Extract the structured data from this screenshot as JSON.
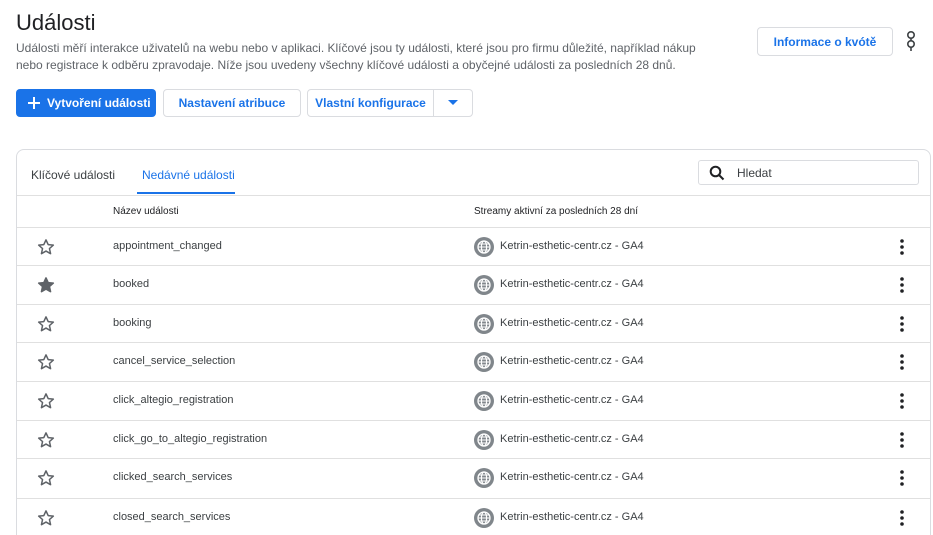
{
  "header": {
    "title": "Události",
    "description": "Události měří interakce uživatelů na webu nebo v aplikaci. Klíčové jsou ty události, které jsou pro firmu důležité, například nákup nebo registrace k odběru zpravodaje. Níže jsou uvedeny všechny klíčové události a obyčejné události za posledních 28 dnů.",
    "quota_label": "Informace o kvótě"
  },
  "toolbar": {
    "create_label": "Vytvoření události",
    "attribution_label": "Nastavení atribuce",
    "custom_config_label": "Vlastní konfigurace"
  },
  "tabs": [
    {
      "label": "Klíčové události",
      "active": false
    },
    {
      "label": "Nedávné události",
      "active": true
    }
  ],
  "search": {
    "placeholder": "Hledat"
  },
  "table": {
    "columns": [
      "Název události",
      "Streamy aktivní za posledních 28 dní"
    ],
    "rows": [
      {
        "name": "appointment_changed",
        "stream": "Ketrin-esthetic-centr.cz - GA4",
        "starred": false
      },
      {
        "name": "booked",
        "stream": "Ketrin-esthetic-centr.cz - GA4",
        "starred": true
      },
      {
        "name": "booking",
        "stream": "Ketrin-esthetic-centr.cz - GA4",
        "starred": false
      },
      {
        "name": "cancel_service_selection",
        "stream": "Ketrin-esthetic-centr.cz - GA4",
        "starred": false
      },
      {
        "name": "click_altegio_registration",
        "stream": "Ketrin-esthetic-centr.cz - GA4",
        "starred": false
      },
      {
        "name": "click_go_to_altegio_registration",
        "stream": "Ketrin-esthetic-centr.cz - GA4",
        "starred": false
      },
      {
        "name": "clicked_search_services",
        "stream": "Ketrin-esthetic-centr.cz - GA4",
        "starred": false
      },
      {
        "name": "closed_search_services",
        "stream": "Ketrin-esthetic-centr.cz - GA4",
        "starred": false
      }
    ]
  },
  "icons": {
    "feedback": "feedback-icon",
    "create": "plus-icon",
    "dropdown": "chevron-down-icon",
    "search": "search-icon",
    "star_outline": "star-outline-icon",
    "star_filled": "star-filled-icon",
    "stream": "globe-icon",
    "more": "more-vert-icon"
  },
  "colors": {
    "accent": "#1a73e8",
    "star": "#5f6368",
    "text": "#202124"
  }
}
